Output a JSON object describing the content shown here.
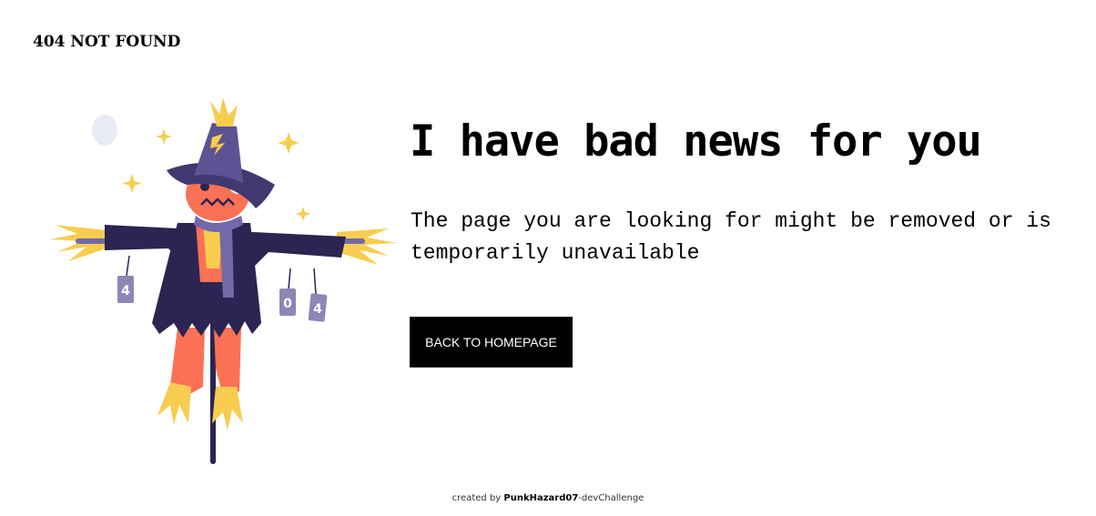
{
  "header": {
    "brand": "404 NOT FOUND"
  },
  "illustration": {
    "can_labels": [
      "4",
      "0",
      "4"
    ],
    "colors": {
      "hat": "#5b5394",
      "hat_dark": "#3f3970",
      "coat": "#2c2452",
      "face": "#fb7155",
      "straw": "#f8cd4f",
      "scarf": "#726aa8",
      "can": "#8d87b8",
      "pole": "#2c2452",
      "moon": "#e8eaf4"
    }
  },
  "main": {
    "headline": "I have bad news for you",
    "message": "The page you are looking for might be removed or is temporarily unavailable",
    "cta_label": "BACK TO HOMEPAGE"
  },
  "footer": {
    "prefix": "created by ",
    "author": "PunkHazard07",
    "suffix": "-devChallenge"
  }
}
